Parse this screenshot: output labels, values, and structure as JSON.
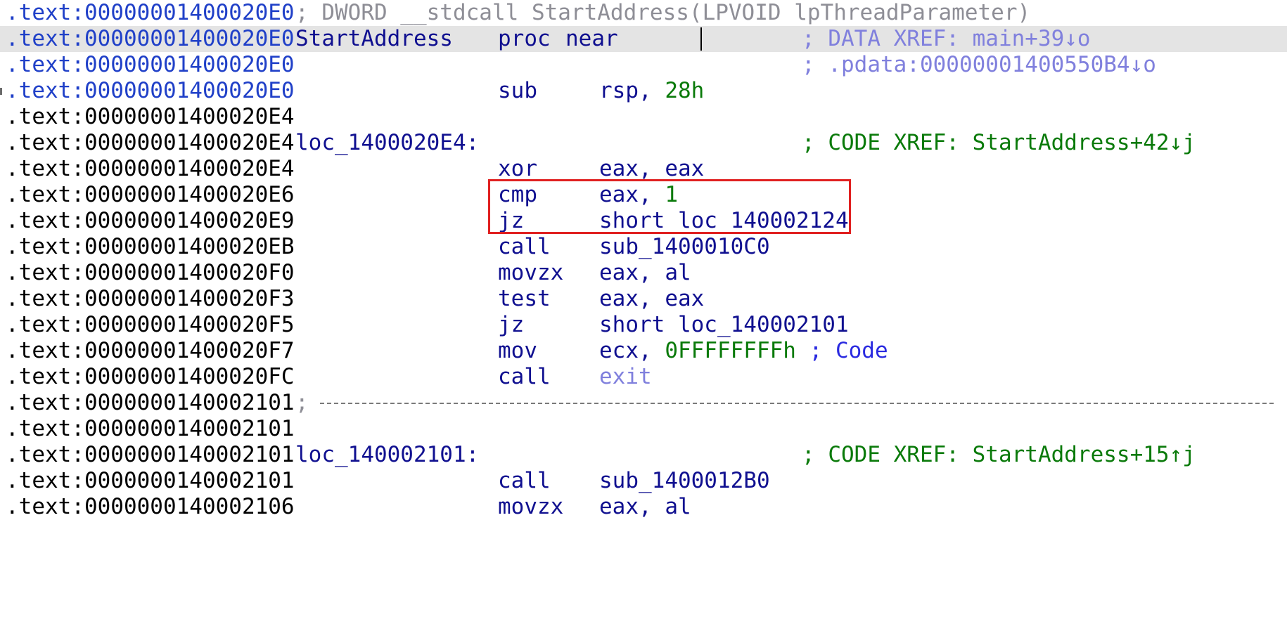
{
  "listing": {
    "rows": [
      {
        "addr": ".text:00000001400020E0",
        "comment": "; DWORD __stdcall StartAddress(LPVOID lpThreadParameter)"
      },
      {
        "addr": ".text:00000001400020E0",
        "label": "StartAddress",
        "mnemonic": "proc",
        "operand": "near",
        "comment": "; DATA XREF: main+39↓o"
      },
      {
        "addr": ".text:00000001400020E0",
        "comment": "; .pdata:00000001400550B4↓o"
      },
      {
        "addr": ".text:00000001400020E0",
        "mnemonic": "sub",
        "operand_reg": "rsp, ",
        "operand_imm": "28h"
      },
      {
        "addr": ".text:00000001400020E4"
      },
      {
        "addr": ".text:00000001400020E4",
        "label": "loc_1400020E4:",
        "comment": "; CODE XREF: StartAddress+42↓j"
      },
      {
        "addr": ".text:00000001400020E4",
        "mnemonic": "xor",
        "operand": "eax, eax"
      },
      {
        "addr": ".text:00000001400020E6",
        "mnemonic": "cmp",
        "operand_reg": "eax, ",
        "operand_imm": "1"
      },
      {
        "addr": ".text:00000001400020E9",
        "mnemonic": "jz",
        "operand": "short loc_140002124"
      },
      {
        "addr": ".text:00000001400020EB",
        "mnemonic": "call",
        "operand": "sub_1400010C0"
      },
      {
        "addr": ".text:00000001400020F0",
        "mnemonic": "movzx",
        "operand": "eax, al"
      },
      {
        "addr": ".text:00000001400020F3",
        "mnemonic": "test",
        "operand": "eax, eax"
      },
      {
        "addr": ".text:00000001400020F5",
        "mnemonic": "jz",
        "operand": "short loc_140002101"
      },
      {
        "addr": ".text:00000001400020F7",
        "mnemonic": "mov",
        "operand_reg": "ecx, ",
        "operand_imm": "0FFFFFFFFh",
        "comment": "; Code"
      },
      {
        "addr": ".text:00000001400020FC",
        "mnemonic": "call",
        "operand": "exit"
      },
      {
        "addr": ".text:0000000140002101",
        "comment": ";"
      },
      {
        "addr": ".text:0000000140002101"
      },
      {
        "addr": ".text:0000000140002101",
        "label": "loc_140002101:",
        "comment": "; CODE XREF: StartAddress+15↑j"
      },
      {
        "addr": ".text:0000000140002101",
        "mnemonic": "call",
        "operand": "sub_1400012B0"
      },
      {
        "addr": ".text:0000000140002106",
        "mnemonic": "movzx",
        "operand": "eax, al"
      }
    ]
  },
  "colors": {
    "address_prolog": "#2040c8",
    "address": "#000000",
    "instruction": "#101090",
    "xref_comment": "#0a7a0a",
    "proc_comment": "#8e8e96",
    "data_xref": "#8080dd",
    "highlight_box": "#e02020",
    "cursor_line": "#e4e4e4"
  }
}
